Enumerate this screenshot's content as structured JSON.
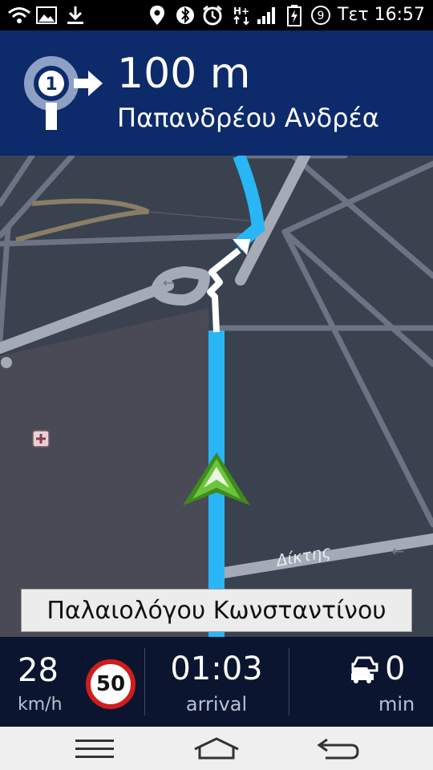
{
  "status_bar": {
    "time": "Τετ 16:57",
    "battery_level_text": "9",
    "icons": [
      "wifi-icon",
      "image-icon",
      "download-icon",
      "location-pin-icon",
      "bluetooth-icon",
      "alarm-icon",
      "h-plus-data-icon",
      "signal-icon",
      "battery-charging-icon",
      "battery-percent-icon"
    ]
  },
  "instruction": {
    "distance": "100 m",
    "street": "Παπανδρέου Ανδρέα",
    "roundabout_exit": "1",
    "icon": "roundabout-exit-icon"
  },
  "map": {
    "street_labels": [
      {
        "text": "Δίκτης"
      }
    ],
    "poi_icons": [
      "hospital-icon"
    ],
    "position_marker": "vehicle-arrow-icon"
  },
  "current_street": "Παλαιολόγου Κωνσταντίνου",
  "info": {
    "speed": "28",
    "speed_unit": "km/h",
    "speed_limit": "50",
    "arrival_time": "01:03",
    "arrival_label": "arrival",
    "traffic_delay": "0",
    "traffic_unit": "min"
  },
  "system_nav": {
    "buttons": [
      "menu-icon",
      "home-icon",
      "back-icon"
    ]
  },
  "colors": {
    "header_bg": "#0d2a6b",
    "route": "#29b6f6",
    "info_bg": "#0c1530",
    "marker": "#5cb82e"
  }
}
